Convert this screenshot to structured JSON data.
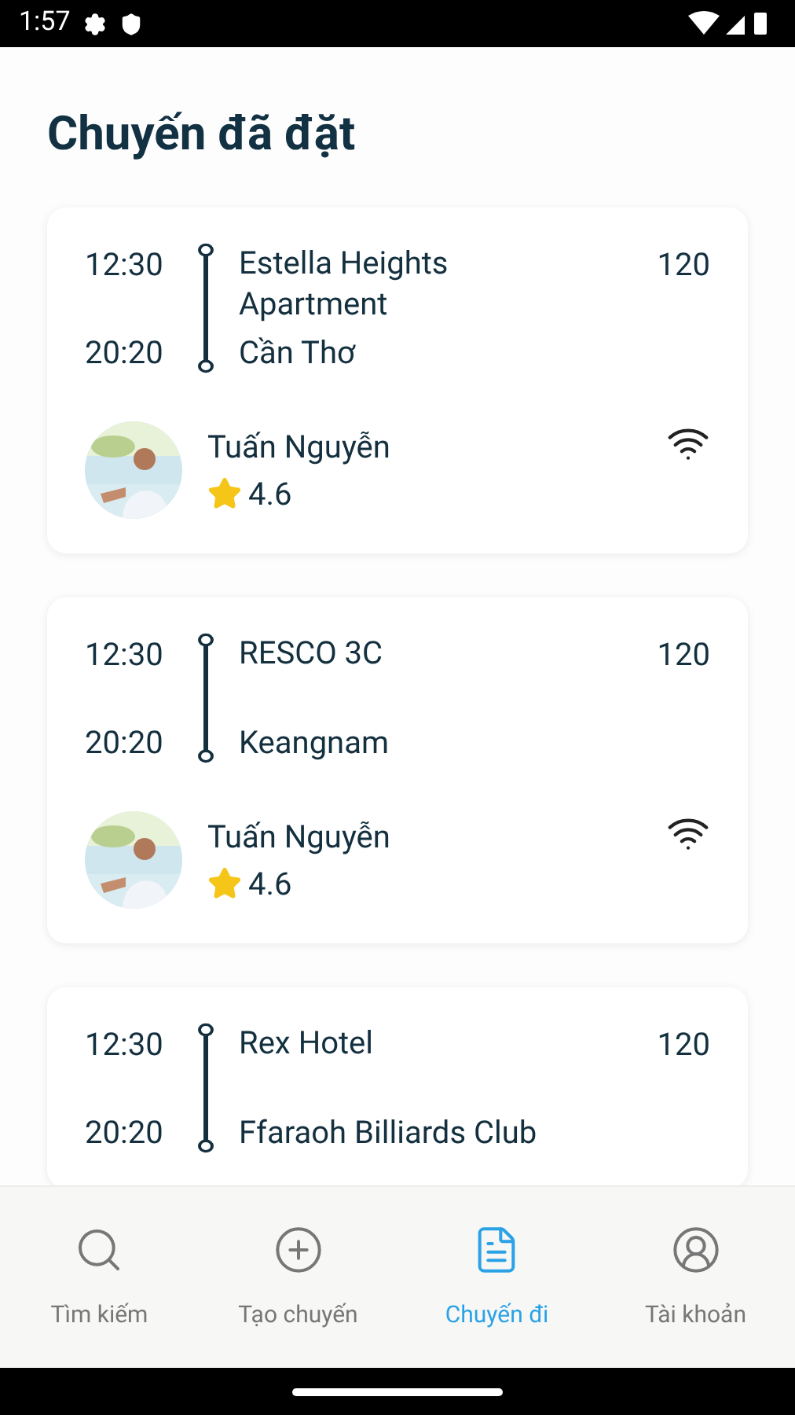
{
  "status_bar": {
    "time": "1:57"
  },
  "title": "Chuyến đã đặt",
  "trips": [
    {
      "depart": "12:30",
      "arrive": "20:20",
      "from": "Estella Heights Apartment",
      "to": "Cần Thơ",
      "price": "120",
      "driver": {
        "name": "Tuấn Nguyễn",
        "rating": "4.6"
      }
    },
    {
      "depart": "12:30",
      "arrive": "20:20",
      "from": "RESCO 3C",
      "to": "Keangnam",
      "price": "120",
      "driver": {
        "name": "Tuấn Nguyễn",
        "rating": "4.6"
      }
    },
    {
      "depart": "12:30",
      "arrive": "20:20",
      "from": "Rex Hotel",
      "to": "Ffaraoh Billiards Club",
      "price": "120"
    }
  ],
  "nav": [
    {
      "kind": "search",
      "label": "Tìm kiếm",
      "selected": false
    },
    {
      "kind": "create",
      "label": "Tạo chuyến",
      "selected": false
    },
    {
      "kind": "trips",
      "label": "Chuyến đi",
      "selected": true
    },
    {
      "kind": "account",
      "label": "Tài khoản",
      "selected": false
    }
  ]
}
